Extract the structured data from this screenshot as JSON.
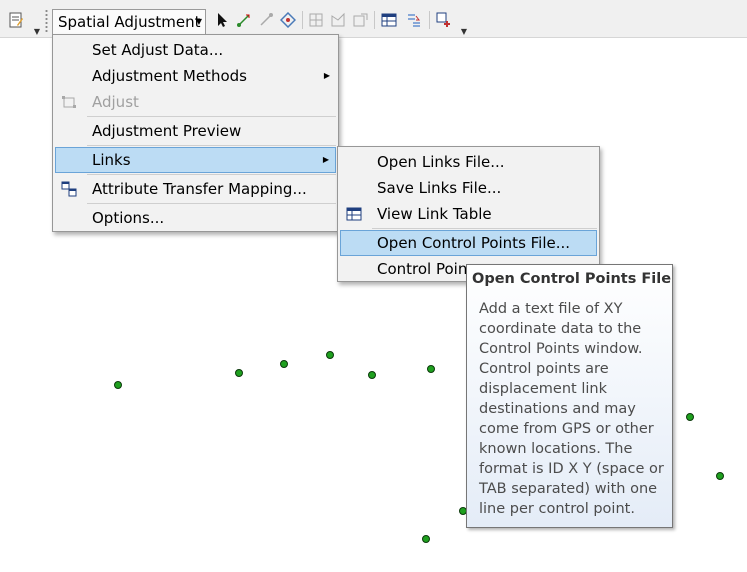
{
  "toolbar": {
    "dropdown_label": "Spatial Adjustment",
    "icons": [
      "editor-icon",
      "more-icon",
      "select-icon",
      "new-displacement-link-icon",
      "modify-link-icon",
      "multiple-displacement-links-icon",
      "grid-icon",
      "identity-link-icon",
      "limited-adjustment-icon",
      "view-link-table-icon",
      "attribute-transfer-icon",
      "edge-match-icon"
    ]
  },
  "menu": {
    "items": [
      {
        "label": "Set Adjust Data..."
      },
      {
        "label": "Adjustment Methods"
      },
      {
        "label": "Adjust"
      },
      {
        "label": "Adjustment Preview"
      },
      {
        "label": "Links"
      },
      {
        "label": "Attribute Transfer Mapping..."
      },
      {
        "label": "Options..."
      }
    ]
  },
  "submenu": {
    "items": [
      {
        "label": "Open Links File..."
      },
      {
        "label": "Save Links File..."
      },
      {
        "label": "View Link Table"
      },
      {
        "label": "Open Control Points File..."
      },
      {
        "label": "Control Poin"
      }
    ]
  },
  "tooltip": {
    "title": "Open Control Points File",
    "body": "Add a text file of XY coordinate data to the Control Points window. Control points are displacement link destinations and may come from GPS or other known locations. The format is ID X Y (space or TAB separated) with one line per control point."
  },
  "colors": {
    "highlight": "#bcdcf4",
    "point_fill": "#1fa01f"
  }
}
